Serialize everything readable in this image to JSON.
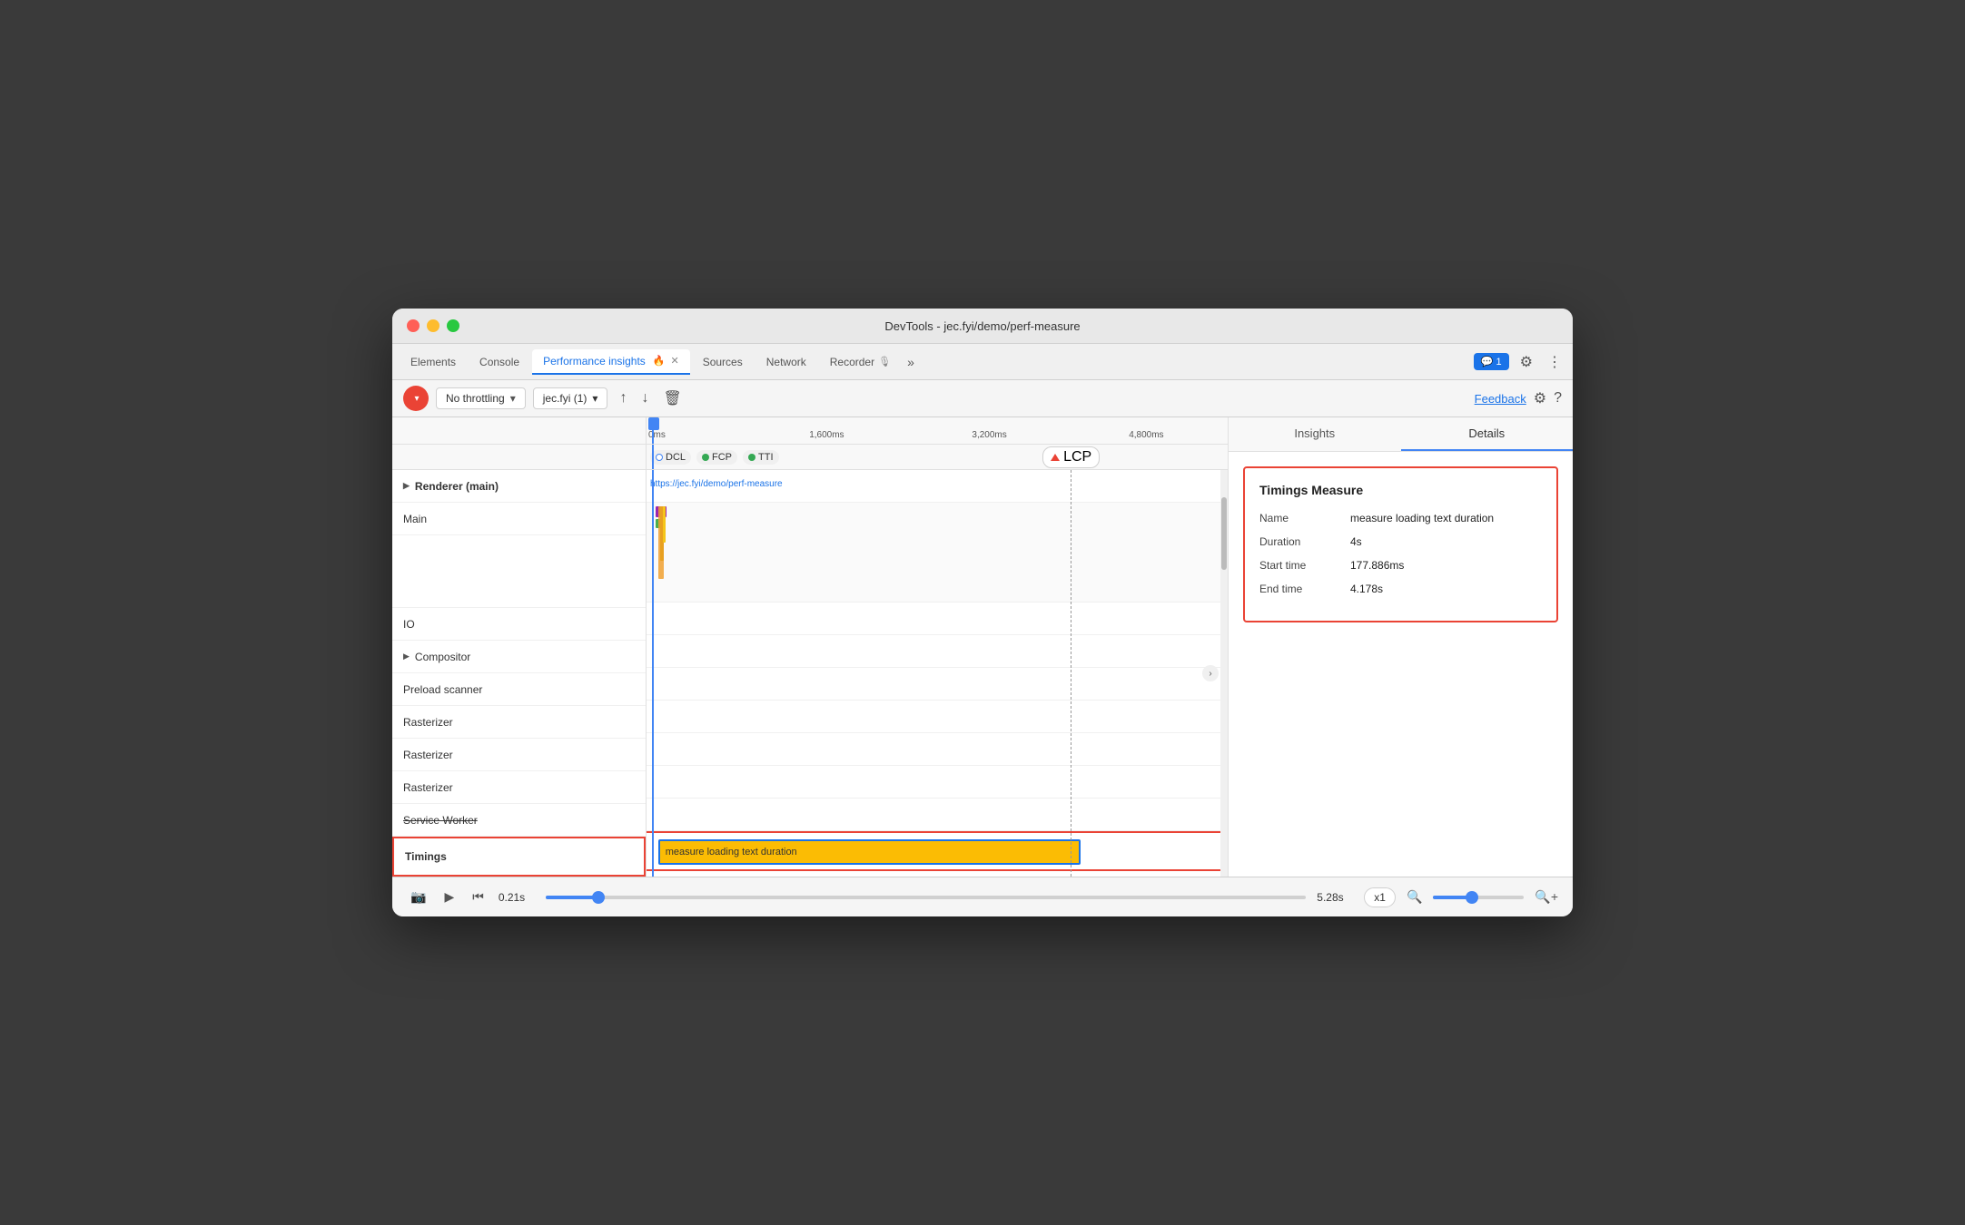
{
  "window": {
    "title": "DevTools - jec.fyi/demo/perf-measure"
  },
  "tabs": [
    {
      "id": "elements",
      "label": "Elements",
      "active": false
    },
    {
      "id": "console",
      "label": "Console",
      "active": false
    },
    {
      "id": "performance-insights",
      "label": "Performance insights",
      "active": true,
      "closable": true
    },
    {
      "id": "sources",
      "label": "Sources",
      "active": false
    },
    {
      "id": "network",
      "label": "Network",
      "active": false
    },
    {
      "id": "recorder",
      "label": "Recorder",
      "active": false
    }
  ],
  "tab_bar_right": {
    "chat_badge": "1",
    "more_label": "⋯"
  },
  "toolbar": {
    "record_label": "Record",
    "throttling_label": "No throttling",
    "throttling_arrow": "▾",
    "url_label": "jec.fyi (1)",
    "url_arrow": "▾",
    "upload_icon": "↑",
    "download_icon": "↓",
    "delete_icon": "🗑",
    "feedback_label": "Feedback",
    "settings_icon": "⚙",
    "help_icon": "?"
  },
  "timeline": {
    "ticks": [
      {
        "label": "0ms",
        "pct": 0
      },
      {
        "label": "1,600ms",
        "pct": 28
      },
      {
        "label": "3,200ms",
        "pct": 56
      },
      {
        "label": "4,800ms",
        "pct": 83
      }
    ],
    "markers": [
      {
        "id": "dcl",
        "label": "DCL",
        "color": "circle-empty"
      },
      {
        "id": "fcp",
        "label": "FCP",
        "color": "green"
      },
      {
        "id": "tti",
        "label": "TTI",
        "color": "green"
      },
      {
        "id": "lcp",
        "label": "LCP",
        "color": "red-triangle"
      }
    ],
    "cursor_pct": 1,
    "dashed_line_pct": 73
  },
  "tracks": [
    {
      "id": "renderer",
      "label": "Renderer (main)",
      "bold": true,
      "arrow": true
    },
    {
      "id": "main",
      "label": "Main",
      "bold": false
    },
    {
      "id": "empty1",
      "label": "",
      "bold": false
    },
    {
      "id": "empty2",
      "label": "",
      "bold": false
    },
    {
      "id": "empty3",
      "label": "",
      "bold": false
    },
    {
      "id": "io",
      "label": "IO",
      "bold": false
    },
    {
      "id": "compositor",
      "label": "Compositor",
      "bold": false,
      "arrow": true
    },
    {
      "id": "preload",
      "label": "Preload scanner",
      "bold": false
    },
    {
      "id": "rasterizer1",
      "label": "Rasterizer",
      "bold": false
    },
    {
      "id": "rasterizer2",
      "label": "Rasterizer",
      "bold": false
    },
    {
      "id": "rasterizer3",
      "label": "Rasterizer",
      "bold": false
    },
    {
      "id": "service-worker",
      "label": "Service Worker",
      "bold": false,
      "strikethrough": true
    }
  ],
  "timings_row": {
    "label": "Timings",
    "measure_label": "measure loading text duration",
    "measure_start_pct": 2,
    "measure_width_pct": 75
  },
  "right_panel": {
    "tabs": [
      {
        "id": "insights",
        "label": "Insights",
        "active": false
      },
      {
        "id": "details",
        "label": "Details",
        "active": true
      }
    ],
    "details": {
      "title": "Timings Measure",
      "rows": [
        {
          "label": "Name",
          "value": "measure loading text duration"
        },
        {
          "label": "Duration",
          "value": "4s"
        },
        {
          "label": "Start time",
          "value": "177.886ms"
        },
        {
          "label": "End time",
          "value": "4.178s"
        }
      ]
    }
  },
  "bottom_bar": {
    "start_time": "0.21s",
    "end_time": "5.28s",
    "speed_label": "x1",
    "slider_pct": 7
  }
}
